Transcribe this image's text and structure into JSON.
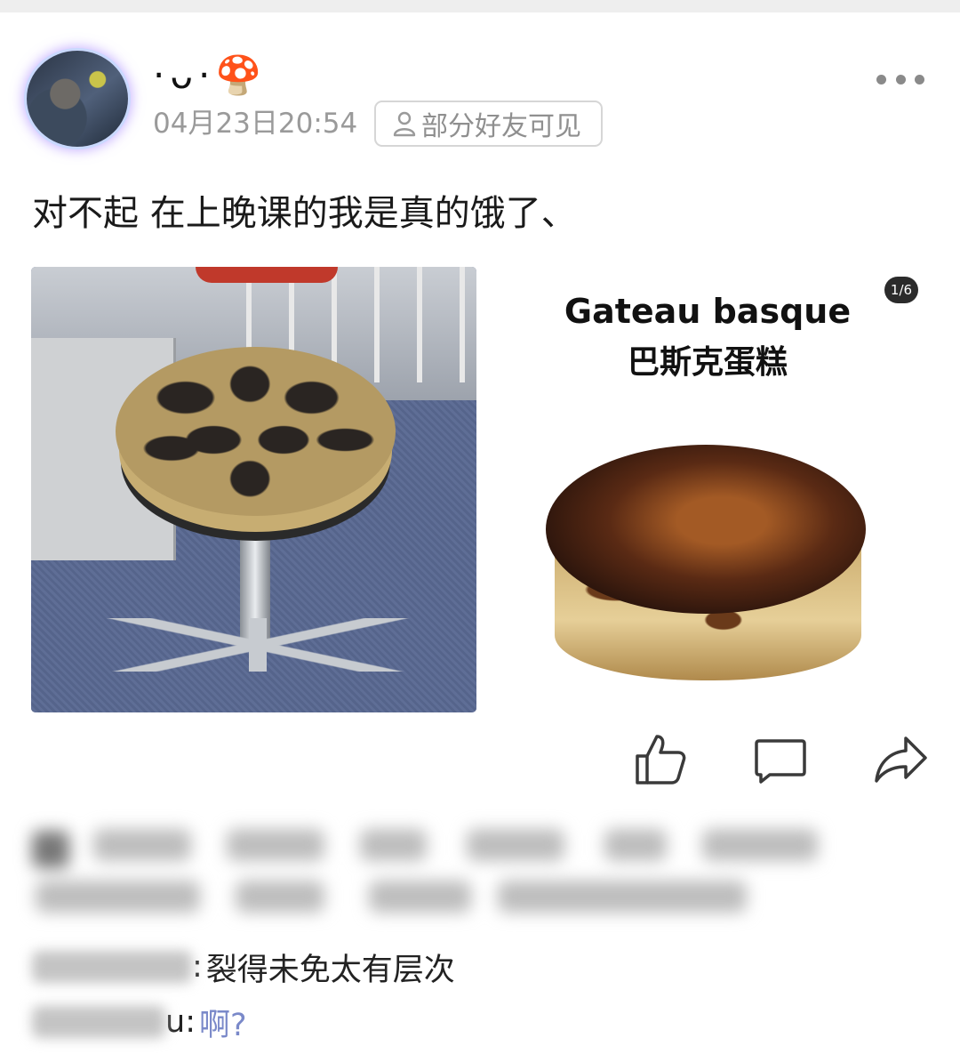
{
  "post": {
    "author": {
      "name": "·ᴗ·🍄"
    },
    "timestamp": "04月23日20:54",
    "visibility": "部分好友可见",
    "text": "对不起 在上晚课的我是真的饿了、",
    "images": [
      {
        "name": "stool-cake-photo"
      },
      {
        "name": "gateau-basque-photo",
        "title_en": "Gateau basque",
        "title_zh": "巴斯克蛋糕"
      }
    ],
    "image_counter": "1/6"
  },
  "actions": [
    {
      "name": "like-button",
      "icon": "thumbs-up-icon"
    },
    {
      "name": "comment-button",
      "icon": "comment-icon"
    },
    {
      "name": "share-button",
      "icon": "share-icon"
    }
  ],
  "comments": [
    {
      "author_visible": "",
      "text": "裂得未免太有层次",
      "style": "normal"
    },
    {
      "author_visible": "u",
      "text": "啊?",
      "style": "link"
    }
  ],
  "colors": {
    "text": "#1a1a1a",
    "muted": "#9a9a9a",
    "link": "#7a89c9",
    "icon": "#3a3a3a"
  }
}
